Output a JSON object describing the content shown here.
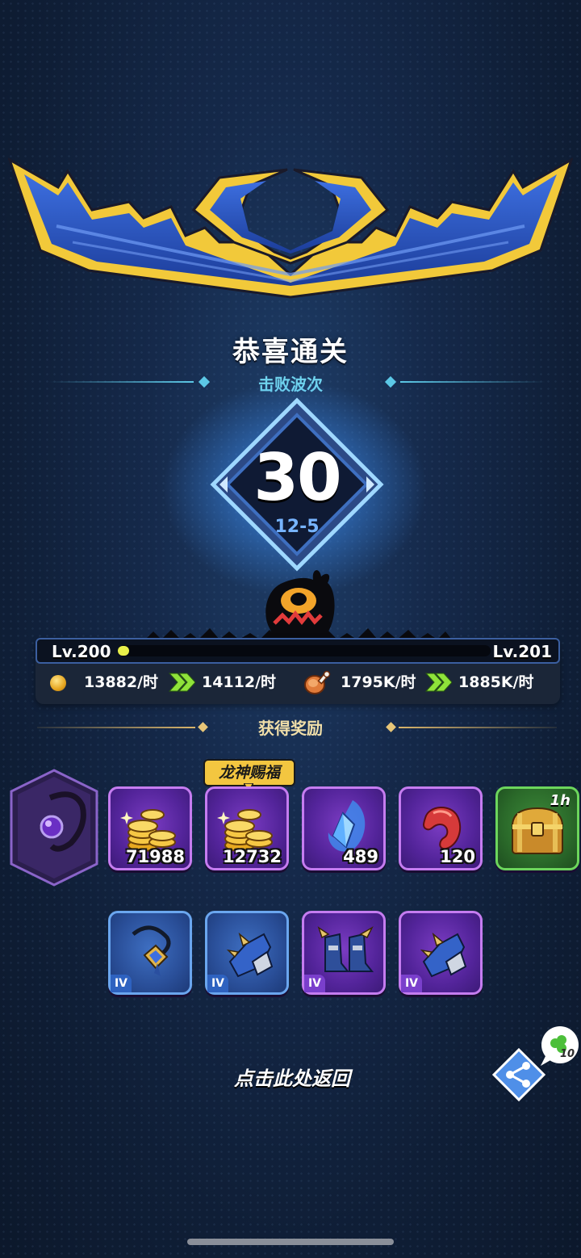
{
  "result": {
    "title": "恭喜通关",
    "subtitle": "击败波次",
    "wave_count": "30",
    "stage": "12-5"
  },
  "level": {
    "current": "Lv.200",
    "next": "Lv.201",
    "progress_fraction": 0.02
  },
  "income": {
    "gold_current": "13882/时",
    "gold_next": "14112/时",
    "food_current": "1795K/时",
    "food_next": "1885K/时"
  },
  "rewards": {
    "title": "获得奖励",
    "bless_label": "龙神赐福",
    "row1": [
      {
        "icon": "gold-coins-icon",
        "qty": "71988",
        "rarity": "purple"
      },
      {
        "icon": "gold-coins-icon",
        "qty": "12732",
        "rarity": "purple"
      },
      {
        "icon": "blue-crystal-icon",
        "qty": "489",
        "rarity": "purple"
      },
      {
        "icon": "red-bean-icon",
        "qty": "120",
        "rarity": "purple"
      },
      {
        "icon": "treasure-chest-icon",
        "tag": "1h",
        "rarity": "green"
      }
    ],
    "row2": [
      {
        "icon": "amulet-icon",
        "tier": "IV",
        "rarity": "blue"
      },
      {
        "icon": "gauntlet-icon",
        "tier": "IV",
        "rarity": "blue"
      },
      {
        "icon": "armored-boots-icon",
        "tier": "IV",
        "rarity": "purple"
      },
      {
        "icon": "gauntlet-icon",
        "tier": "IV",
        "rarity": "purple"
      }
    ]
  },
  "footer": {
    "back_label": "点击此处返回",
    "clover_count": "10"
  },
  "colors": {
    "accent_cyan": "#6fd3ee",
    "reward_gold": "#f1dfa9",
    "purple_frame": "#c57cf0",
    "blue_frame": "#6aa6ef",
    "green_frame": "#6cd65c"
  }
}
